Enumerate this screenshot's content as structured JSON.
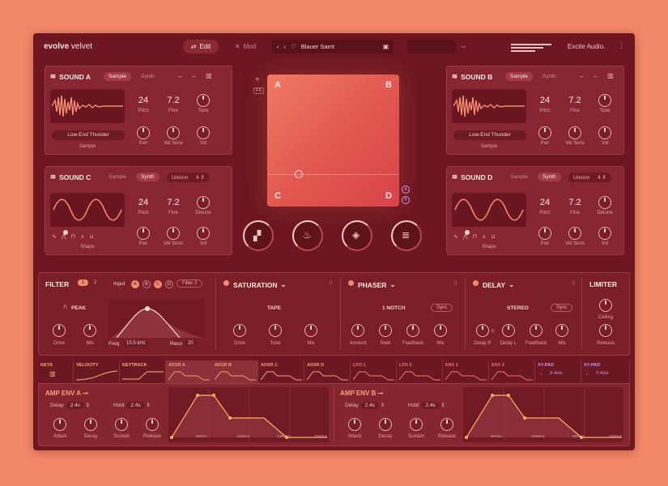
{
  "brand": {
    "bold": "evolve",
    "light": "velvet"
  },
  "topbar": {
    "edit_label": "Edit",
    "mod_label": "Mod",
    "preset_name": "Blauer Samt",
    "company": "Excite Audio."
  },
  "sound_a": {
    "title": "SOUND A",
    "tab_sample": "Sample",
    "tab_synth": "Synth",
    "sample_name": "Low-End Thunder",
    "sample_label": "Sample",
    "pitch": "24",
    "pitch_label": "Pitch",
    "fine": "7.2",
    "fine_label": "Fine",
    "tone_label": "Tone",
    "pan_label": "Pan",
    "velsens_label": "Vel Sens",
    "vol_label": "Vol"
  },
  "sound_b": {
    "title": "SOUND B",
    "tab_sample": "Sample",
    "tab_synth": "Synth",
    "sample_name": "Low-End Thunder",
    "sample_label": "Sample",
    "pitch": "24",
    "pitch_label": "Pitch",
    "fine": "7.2",
    "fine_label": "Fine",
    "tone_label": "Tone",
    "pan_label": "Pan",
    "velsens_label": "Vel Sens",
    "vol_label": "Vol"
  },
  "sound_c": {
    "title": "SOUND C",
    "tab_sample": "Sample",
    "tab_synth": "Synth",
    "unison_label": "Unison",
    "unison_value": "4",
    "shape_label": "Shape",
    "pitch": "24",
    "pitch_label": "Pitch",
    "fine": "7.2",
    "fine_label": "Fine",
    "detune_label": "Detune",
    "pan_label": "Pan",
    "velsens_label": "Vel Sens",
    "vol_label": "Vol"
  },
  "sound_d": {
    "title": "SOUND D",
    "tab_sample": "Sample",
    "tab_synth": "Synth",
    "unison_label": "Unison",
    "unison_value": "4",
    "shape_label": "Shape",
    "pitch": "24",
    "pitch_label": "Pitch",
    "fine": "7.2",
    "fine_label": "Fine",
    "detune_label": "Detune",
    "pan_label": "Pan",
    "velsens_label": "Vel Sens",
    "vol_label": "Vol"
  },
  "xypad": {
    "a": "A",
    "b": "B",
    "c": "C",
    "d": "D",
    "fx": "FX",
    "x": "X",
    "y": "Y"
  },
  "filter": {
    "title": "FILTER",
    "slot1": "1",
    "slot2": "2",
    "input_label": "Input",
    "inputs": [
      "A",
      "B",
      "C",
      "D"
    ],
    "filter2": "Filter 2",
    "type": "PEAK",
    "drive_label": "Drive",
    "mix_label": "Mix",
    "freq_label": "Freq",
    "freq_value": "10.5 kHz",
    "reso_label": "Reso",
    "reso_value": "20"
  },
  "saturation": {
    "title": "SATURATION",
    "mode": "TAPE",
    "drive_label": "Drive",
    "tone_label": "Tone",
    "mix_label": "Mix"
  },
  "phaser": {
    "title": "PHASER",
    "mode": "1 NOTCH",
    "sync": "Sync",
    "amount_label": "Amount",
    "rate_label": "Rate",
    "feedback_label": "Feedback",
    "mix_label": "Mix"
  },
  "delay": {
    "title": "DELAY",
    "mode": "STEREO",
    "sync": "Sync",
    "delayr_label": "Delay R",
    "delayl_label": "Delay L",
    "feedback_label": "Feedback",
    "mix_label": "Mix"
  },
  "limiter": {
    "title": "LIMITER",
    "ceiling_label": "Ceiling",
    "release_label": "Release"
  },
  "mod_tabs": [
    {
      "name": "KEYS",
      "color": "#f5b36a"
    },
    {
      "name": "VELOCITY",
      "color": "#f5b36a"
    },
    {
      "name": "KEYTRACK",
      "color": "#f5b36a"
    },
    {
      "name": "ADSR A",
      "color": "#f49a7a"
    },
    {
      "name": "ADSR B",
      "color": "#f49a7a"
    },
    {
      "name": "ADSR C",
      "color": "#f49a7a"
    },
    {
      "name": "ADSR D",
      "color": "#f49a7a"
    },
    {
      "name": "LFO 1",
      "color": "#f27b6f"
    },
    {
      "name": "LFO 2",
      "color": "#f27b6f"
    },
    {
      "name": "ENV 1",
      "color": "#ef6f8a"
    },
    {
      "name": "ENV 2",
      "color": "#ef6f8a"
    },
    {
      "name": "XY-PAD",
      "color": "#c995f0",
      "sub": "X-Axis"
    },
    {
      "name": "XY-PAD",
      "color": "#c995f0",
      "sub": "Y-Axis"
    }
  ],
  "amp_env_a": {
    "title": "AMP ENV A",
    "delay_label": "Delay",
    "delay_value": "2.4s",
    "hold_label": "Hold",
    "hold_value": "2.4s",
    "attack_label": "Attack",
    "decay_label": "Decay",
    "sustain_label": "Sustain",
    "release_label": "Release",
    "ticks": [
      "500ms",
      "1000ms",
      "1500ms",
      "2000ms"
    ]
  },
  "amp_env_b": {
    "title": "AMP ENV B",
    "delay_label": "Delay",
    "delay_value": "2.4s",
    "hold_label": "Hold",
    "hold_value": "2.4s",
    "attack_label": "Attack",
    "decay_label": "Decay",
    "sustain_label": "Sustain",
    "release_label": "Release",
    "ticks": [
      "500ms",
      "1000ms",
      "1500ms",
      "2000ms"
    ]
  }
}
